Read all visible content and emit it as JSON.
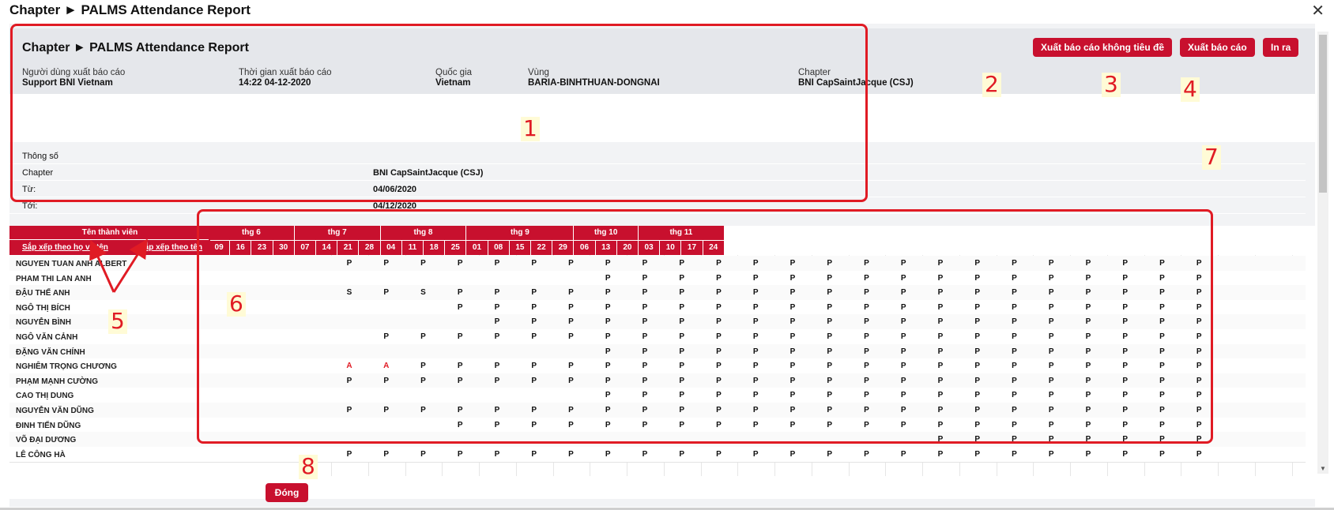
{
  "window": {
    "title": "Chapter ► PALMS Attendance Report",
    "close_glyph": "✕"
  },
  "header": {
    "report_title": "Chapter ► PALMS Attendance Report",
    "meta": [
      {
        "label": "Người dùng xuất báo cáo",
        "value": "Support BNI Vietnam"
      },
      {
        "label": "Thời gian xuất báo cáo",
        "value": "14:22 04-12-2020"
      },
      {
        "label": "Quốc gia",
        "value": "Vietnam"
      },
      {
        "label": "Vùng",
        "value": "BARIA-BINHTHUAN-DONGNAI"
      },
      {
        "label": "Chapter",
        "value": "BNI CapSaintJacque (CSJ)"
      }
    ]
  },
  "toolbar": {
    "export_no_title": "Xuất báo cáo không tiêu đề",
    "export": "Xuất báo cáo",
    "print": "In ra"
  },
  "params": {
    "heading": "Thông số",
    "rows": [
      {
        "label": "Chapter",
        "value": "BNI CapSaintJacque (CSJ)"
      },
      {
        "label": "Từ:",
        "value": "04/06/2020"
      },
      {
        "label": "Tới:",
        "value": "04/12/2020"
      }
    ]
  },
  "grid": {
    "member_header": "Tên thành viên",
    "sort_by_fullname": "Sắp xếp theo họ và tên",
    "sort_by_name": "Sắp xếp theo tên",
    "months": [
      {
        "label": "thg 6",
        "days": [
          "09",
          "16",
          "23",
          "30"
        ]
      },
      {
        "label": "thg 7",
        "days": [
          "07",
          "14",
          "21",
          "28"
        ]
      },
      {
        "label": "thg 8",
        "days": [
          "04",
          "11",
          "18",
          "25"
        ]
      },
      {
        "label": "thg 9",
        "days": [
          "01",
          "08",
          "15",
          "22",
          "29"
        ]
      },
      {
        "label": "thg 10",
        "days": [
          "06",
          "13",
          "20"
        ]
      },
      {
        "label": "thg 11",
        "days": [
          "03",
          "10",
          "17",
          "24"
        ]
      }
    ],
    "rows": [
      {
        "name": "NGUYEN TUAN ANH ALBERT",
        "marks": [
          "",
          "",
          "",
          "P",
          "P",
          "P",
          "P",
          "P",
          "P",
          "P",
          "P",
          "P",
          "P",
          "P",
          "P",
          "P",
          "P",
          "P",
          "P",
          "P",
          "P",
          "P",
          "P",
          "P",
          "P",
          "P",
          "P"
        ]
      },
      {
        "name": "PHAM THI LAN ANH",
        "marks": [
          "",
          "",
          "",
          "",
          "",
          "",
          "",
          "",
          "",
          "",
          "P",
          "P",
          "P",
          "P",
          "P",
          "P",
          "P",
          "P",
          "P",
          "P",
          "P",
          "P",
          "P",
          "P",
          "P",
          "P",
          "P"
        ]
      },
      {
        "name": "ĐẬU THẾ ANH",
        "marks": [
          "",
          "",
          "",
          "S",
          "P",
          "S",
          "P",
          "P",
          "P",
          "P",
          "P",
          "P",
          "P",
          "P",
          "P",
          "P",
          "P",
          "P",
          "P",
          "P",
          "P",
          "P",
          "P",
          "P",
          "P",
          "P",
          "P"
        ]
      },
      {
        "name": "NGÔ THỊ BÍCH",
        "marks": [
          "",
          "",
          "",
          "",
          "",
          "",
          "P",
          "P",
          "P",
          "P",
          "P",
          "P",
          "P",
          "P",
          "P",
          "P",
          "P",
          "P",
          "P",
          "P",
          "P",
          "P",
          "P",
          "P",
          "P",
          "P",
          "P"
        ]
      },
      {
        "name": "NGUYỄN BÌNH",
        "marks": [
          "",
          "",
          "",
          "",
          "",
          "",
          "",
          "P",
          "P",
          "P",
          "P",
          "P",
          "P",
          "P",
          "P",
          "P",
          "P",
          "P",
          "P",
          "P",
          "P",
          "P",
          "P",
          "P",
          "P",
          "P",
          "P"
        ]
      },
      {
        "name": "NGÔ VĂN CẢNH",
        "marks": [
          "",
          "",
          "",
          "",
          "P",
          "P",
          "P",
          "P",
          "P",
          "P",
          "P",
          "P",
          "P",
          "P",
          "P",
          "P",
          "P",
          "P",
          "P",
          "P",
          "P",
          "P",
          "P",
          "P",
          "P",
          "P",
          "P"
        ]
      },
      {
        "name": "ĐẶNG VĂN CHÍNH",
        "marks": [
          "",
          "",
          "",
          "",
          "",
          "",
          "",
          "",
          "",
          "",
          "P",
          "P",
          "P",
          "P",
          "P",
          "P",
          "P",
          "P",
          "P",
          "P",
          "P",
          "P",
          "P",
          "P",
          "P",
          "P",
          "P"
        ]
      },
      {
        "name": "NGHIÊM TRỌNG CHƯƠNG",
        "marks": [
          "",
          "",
          "",
          "A",
          "A",
          "P",
          "P",
          "P",
          "P",
          "P",
          "P",
          "P",
          "P",
          "P",
          "P",
          "P",
          "P",
          "P",
          "P",
          "P",
          "P",
          "P",
          "P",
          "P",
          "P",
          "P",
          "P"
        ]
      },
      {
        "name": "PHẠM MẠNH CƯỜNG",
        "marks": [
          "",
          "",
          "",
          "P",
          "P",
          "P",
          "P",
          "P",
          "P",
          "P",
          "P",
          "P",
          "P",
          "P",
          "P",
          "P",
          "P",
          "P",
          "P",
          "P",
          "P",
          "P",
          "P",
          "P",
          "P",
          "P",
          "P"
        ]
      },
      {
        "name": "CAO THỊ DUNG",
        "marks": [
          "",
          "",
          "",
          "",
          "",
          "",
          "",
          "",
          "",
          "",
          "P",
          "P",
          "P",
          "P",
          "P",
          "P",
          "P",
          "P",
          "P",
          "P",
          "P",
          "P",
          "P",
          "P",
          "P",
          "P",
          "P"
        ]
      },
      {
        "name": "NGUYỄN VĂN DŨNG",
        "marks": [
          "",
          "",
          "",
          "P",
          "P",
          "P",
          "P",
          "P",
          "P",
          "P",
          "P",
          "P",
          "P",
          "P",
          "P",
          "P",
          "P",
          "P",
          "P",
          "P",
          "P",
          "P",
          "P",
          "P",
          "P",
          "P",
          "P"
        ]
      },
      {
        "name": "ĐINH TIẾN  DŨNG",
        "marks": [
          "",
          "",
          "",
          "",
          "",
          "",
          "P",
          "P",
          "P",
          "P",
          "P",
          "P",
          "P",
          "P",
          "P",
          "P",
          "P",
          "P",
          "P",
          "P",
          "P",
          "P",
          "P",
          "P",
          "P",
          "P",
          "P"
        ]
      },
      {
        "name": "VÕ ĐẠI DƯƠNG",
        "marks": [
          "",
          "",
          "",
          "",
          "",
          "",
          "",
          "",
          "",
          "",
          "",
          "",
          "",
          "",
          "",
          "",
          "",
          "",
          "",
          "P",
          "P",
          "P",
          "P",
          "P",
          "P",
          "P",
          "P"
        ]
      },
      {
        "name": "LÊ CÔNG HÀ",
        "marks": [
          "",
          "",
          "",
          "P",
          "P",
          "P",
          "P",
          "P",
          "P",
          "P",
          "P",
          "P",
          "P",
          "P",
          "P",
          "P",
          "P",
          "P",
          "P",
          "P",
          "P",
          "P",
          "P",
          "P",
          "P",
          "P",
          "P"
        ]
      }
    ]
  },
  "footer": {
    "close": "Đóng"
  },
  "annotations": [
    "1",
    "2",
    "3",
    "4",
    "5",
    "6",
    "7",
    "8"
  ]
}
